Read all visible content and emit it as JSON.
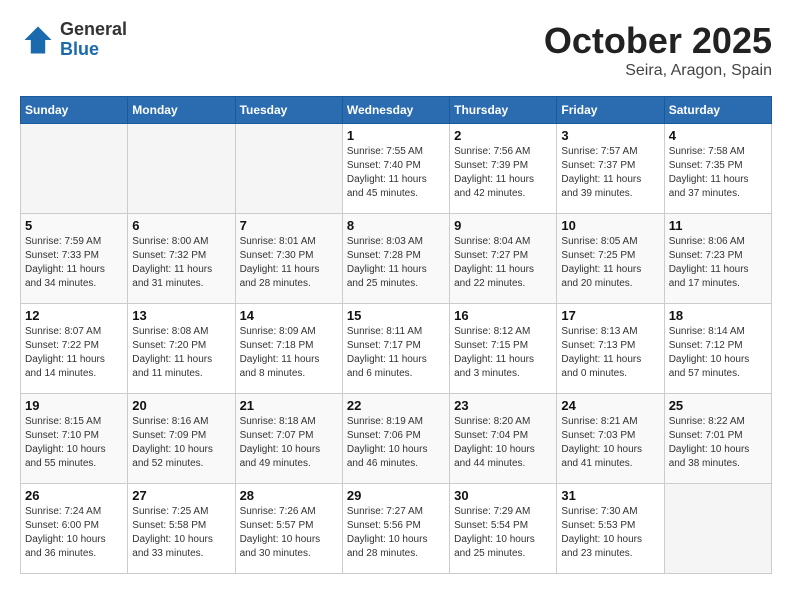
{
  "header": {
    "logo_general": "General",
    "logo_blue": "Blue",
    "month": "October 2025",
    "location": "Seira, Aragon, Spain"
  },
  "days_of_week": [
    "Sunday",
    "Monday",
    "Tuesday",
    "Wednesday",
    "Thursday",
    "Friday",
    "Saturday"
  ],
  "weeks": [
    [
      {
        "day": "",
        "info": ""
      },
      {
        "day": "",
        "info": ""
      },
      {
        "day": "",
        "info": ""
      },
      {
        "day": "1",
        "info": "Sunrise: 7:55 AM\nSunset: 7:40 PM\nDaylight: 11 hours and 45 minutes."
      },
      {
        "day": "2",
        "info": "Sunrise: 7:56 AM\nSunset: 7:39 PM\nDaylight: 11 hours and 42 minutes."
      },
      {
        "day": "3",
        "info": "Sunrise: 7:57 AM\nSunset: 7:37 PM\nDaylight: 11 hours and 39 minutes."
      },
      {
        "day": "4",
        "info": "Sunrise: 7:58 AM\nSunset: 7:35 PM\nDaylight: 11 hours and 37 minutes."
      }
    ],
    [
      {
        "day": "5",
        "info": "Sunrise: 7:59 AM\nSunset: 7:33 PM\nDaylight: 11 hours and 34 minutes."
      },
      {
        "day": "6",
        "info": "Sunrise: 8:00 AM\nSunset: 7:32 PM\nDaylight: 11 hours and 31 minutes."
      },
      {
        "day": "7",
        "info": "Sunrise: 8:01 AM\nSunset: 7:30 PM\nDaylight: 11 hours and 28 minutes."
      },
      {
        "day": "8",
        "info": "Sunrise: 8:03 AM\nSunset: 7:28 PM\nDaylight: 11 hours and 25 minutes."
      },
      {
        "day": "9",
        "info": "Sunrise: 8:04 AM\nSunset: 7:27 PM\nDaylight: 11 hours and 22 minutes."
      },
      {
        "day": "10",
        "info": "Sunrise: 8:05 AM\nSunset: 7:25 PM\nDaylight: 11 hours and 20 minutes."
      },
      {
        "day": "11",
        "info": "Sunrise: 8:06 AM\nSunset: 7:23 PM\nDaylight: 11 hours and 17 minutes."
      }
    ],
    [
      {
        "day": "12",
        "info": "Sunrise: 8:07 AM\nSunset: 7:22 PM\nDaylight: 11 hours and 14 minutes."
      },
      {
        "day": "13",
        "info": "Sunrise: 8:08 AM\nSunset: 7:20 PM\nDaylight: 11 hours and 11 minutes."
      },
      {
        "day": "14",
        "info": "Sunrise: 8:09 AM\nSunset: 7:18 PM\nDaylight: 11 hours and 8 minutes."
      },
      {
        "day": "15",
        "info": "Sunrise: 8:11 AM\nSunset: 7:17 PM\nDaylight: 11 hours and 6 minutes."
      },
      {
        "day": "16",
        "info": "Sunrise: 8:12 AM\nSunset: 7:15 PM\nDaylight: 11 hours and 3 minutes."
      },
      {
        "day": "17",
        "info": "Sunrise: 8:13 AM\nSunset: 7:13 PM\nDaylight: 11 hours and 0 minutes."
      },
      {
        "day": "18",
        "info": "Sunrise: 8:14 AM\nSunset: 7:12 PM\nDaylight: 10 hours and 57 minutes."
      }
    ],
    [
      {
        "day": "19",
        "info": "Sunrise: 8:15 AM\nSunset: 7:10 PM\nDaylight: 10 hours and 55 minutes."
      },
      {
        "day": "20",
        "info": "Sunrise: 8:16 AM\nSunset: 7:09 PM\nDaylight: 10 hours and 52 minutes."
      },
      {
        "day": "21",
        "info": "Sunrise: 8:18 AM\nSunset: 7:07 PM\nDaylight: 10 hours and 49 minutes."
      },
      {
        "day": "22",
        "info": "Sunrise: 8:19 AM\nSunset: 7:06 PM\nDaylight: 10 hours and 46 minutes."
      },
      {
        "day": "23",
        "info": "Sunrise: 8:20 AM\nSunset: 7:04 PM\nDaylight: 10 hours and 44 minutes."
      },
      {
        "day": "24",
        "info": "Sunrise: 8:21 AM\nSunset: 7:03 PM\nDaylight: 10 hours and 41 minutes."
      },
      {
        "day": "25",
        "info": "Sunrise: 8:22 AM\nSunset: 7:01 PM\nDaylight: 10 hours and 38 minutes."
      }
    ],
    [
      {
        "day": "26",
        "info": "Sunrise: 7:24 AM\nSunset: 6:00 PM\nDaylight: 10 hours and 36 minutes."
      },
      {
        "day": "27",
        "info": "Sunrise: 7:25 AM\nSunset: 5:58 PM\nDaylight: 10 hours and 33 minutes."
      },
      {
        "day": "28",
        "info": "Sunrise: 7:26 AM\nSunset: 5:57 PM\nDaylight: 10 hours and 30 minutes."
      },
      {
        "day": "29",
        "info": "Sunrise: 7:27 AM\nSunset: 5:56 PM\nDaylight: 10 hours and 28 minutes."
      },
      {
        "day": "30",
        "info": "Sunrise: 7:29 AM\nSunset: 5:54 PM\nDaylight: 10 hours and 25 minutes."
      },
      {
        "day": "31",
        "info": "Sunrise: 7:30 AM\nSunset: 5:53 PM\nDaylight: 10 hours and 23 minutes."
      },
      {
        "day": "",
        "info": ""
      }
    ]
  ]
}
